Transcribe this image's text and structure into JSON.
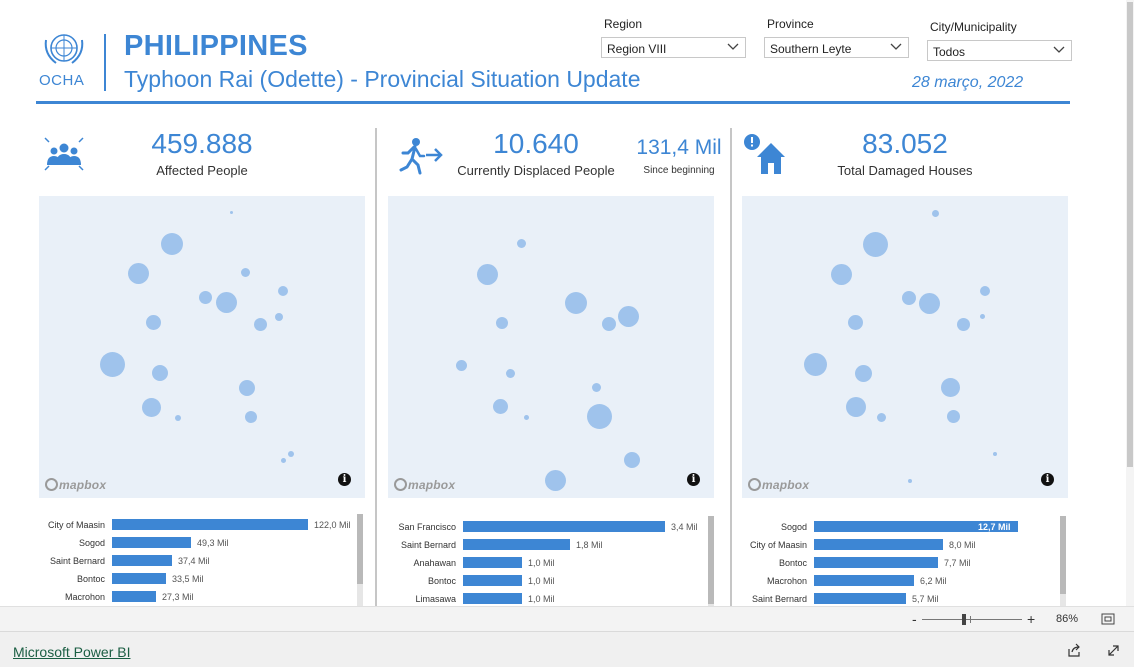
{
  "header": {
    "logo_text": "OCHA",
    "title": "PHILIPPINES",
    "subtitle": "Typhoon Rai (Odette) - Provincial Situation Update",
    "date": "28 março, 2022"
  },
  "filters": {
    "region": {
      "label": "Region",
      "value": "Region VIII"
    },
    "province": {
      "label": "Province",
      "value": "Southern Leyte"
    },
    "city": {
      "label": "City/Municipality",
      "value": "Todos"
    }
  },
  "panels": [
    {
      "icon": "people-group-icon",
      "value": "459.888",
      "label": "Affected People",
      "map_brand": "mapbox",
      "chart_data": {
        "type": "bar",
        "categories": [
          "City of Maasin",
          "Sogod",
          "Saint Bernard",
          "Bontoc",
          "Macrohon"
        ],
        "values": [
          122.0,
          49.3,
          37.4,
          33.5,
          27.3
        ],
        "value_labels": [
          "122,0 Mil",
          "49,3 Mil",
          "37,4 Mil",
          "33,5 Mil",
          "27,3 Mil"
        ],
        "unit": "Mil"
      }
    },
    {
      "icon": "running-person-arrow-icon",
      "value": "10.640",
      "label": "Currently Displaced People",
      "secondary_value": "131,4 Mil",
      "secondary_label": "Since beginning",
      "map_brand": "mapbox",
      "chart_data": {
        "type": "bar",
        "categories": [
          "San Francisco",
          "Saint Bernard",
          "Anahawan",
          "Bontoc",
          "Limasawa"
        ],
        "values": [
          3.4,
          1.8,
          1.0,
          1.0,
          1.0
        ],
        "value_labels": [
          "3,4 Mil",
          "1,8 Mil",
          "1,0 Mil",
          "1,0 Mil",
          "1,0 Mil"
        ],
        "unit": "Mil"
      }
    },
    {
      "icon": "damaged-house-icon",
      "value": "83.052",
      "label": "Total Damaged Houses",
      "map_brand": "mapbox",
      "chart_data": {
        "type": "bar",
        "categories": [
          "Sogod",
          "City of Maasin",
          "Bontoc",
          "Macrohon",
          "Saint Bernard"
        ],
        "values": [
          12.7,
          8.0,
          7.7,
          6.2,
          5.7
        ],
        "value_labels": [
          "12,7 Mil",
          "8,0 Mil",
          "7,7 Mil",
          "6,2 Mil",
          "5,7 Mil"
        ],
        "unit": "Mil"
      }
    }
  ],
  "zoom": {
    "minus": "-",
    "plus": "+",
    "level": "86%"
  },
  "footer": {
    "link": "Microsoft Power BI"
  },
  "colors": {
    "accent": "#3d86d4",
    "bubble": "#9fc3ec",
    "map_bg": "#e9f0f8"
  }
}
